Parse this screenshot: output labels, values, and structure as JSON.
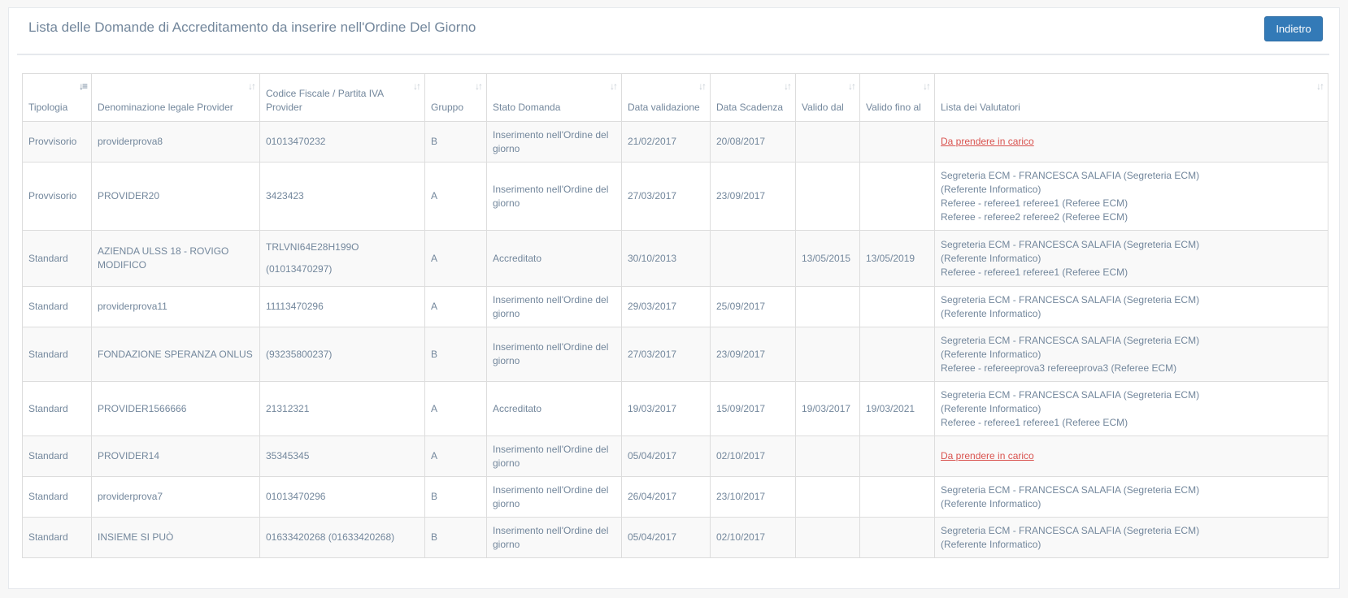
{
  "page": {
    "title": "Lista delle Domande di Accreditamento da inserire nell'Ordine Del Giorno",
    "back_label": "Indietro"
  },
  "table": {
    "headers": [
      "Tipologia",
      "Denominazione legale Provider",
      "Codice Fiscale / Partita IVA Provider",
      "Gruppo",
      "Stato Domanda",
      "Data validazione",
      "Data Scadenza",
      "Valido dal",
      "Valido fino al",
      "Lista dei Valutatori"
    ],
    "rows": [
      {
        "tipologia": "Provvisorio",
        "denominazione": "providerprova8",
        "codice": "01013470232",
        "gruppo": "B",
        "stato": "Inserimento nell'Ordine del giorno",
        "data_validazione": "21/02/2017",
        "data_scadenza": "20/08/2017",
        "valido_dal": "",
        "valido_fino": "",
        "valutatori_link": "Da prendere in carico",
        "valutatori": []
      },
      {
        "tipologia": "Provvisorio",
        "denominazione": "PROVIDER20",
        "codice": "3423423",
        "gruppo": "A",
        "stato": "Inserimento nell'Ordine del giorno",
        "data_validazione": "27/03/2017",
        "data_scadenza": "23/09/2017",
        "valido_dal": "",
        "valido_fino": "",
        "valutatori_link": "",
        "valutatori": [
          "Segreteria ECM - FRANCESCA SALAFIA (Segreteria ECM)",
          "(Referente Informatico)",
          "Referee - referee1 referee1 (Referee ECM)",
          "Referee - referee2 referee2 (Referee ECM)"
        ]
      },
      {
        "tipologia": "Standard",
        "denominazione": "AZIENDA ULSS 18 - ROVIGO MODIFICO",
        "codice": "TRLVNI64E28H199O",
        "codice_sub": "(01013470297)",
        "gruppo": "A",
        "stato": "Accreditato",
        "data_validazione": "30/10/2013",
        "data_scadenza": "",
        "valido_dal": "13/05/2015",
        "valido_fino": "13/05/2019",
        "valutatori_link": "",
        "valutatori": [
          "Segreteria ECM - FRANCESCA SALAFIA (Segreteria ECM)",
          "(Referente Informatico)",
          "Referee - referee1 referee1 (Referee ECM)"
        ]
      },
      {
        "tipologia": "Standard",
        "denominazione": "providerprova11",
        "codice": "11113470296",
        "gruppo": "A",
        "stato": "Inserimento nell'Ordine del giorno",
        "data_validazione": "29/03/2017",
        "data_scadenza": "25/09/2017",
        "valido_dal": "",
        "valido_fino": "",
        "valutatori_link": "",
        "valutatori": [
          "Segreteria ECM - FRANCESCA SALAFIA (Segreteria ECM)",
          "(Referente Informatico)"
        ]
      },
      {
        "tipologia": "Standard",
        "denominazione": "FONDAZIONE SPERANZA ONLUS",
        "codice": "(93235800237)",
        "gruppo": "B",
        "stato": "Inserimento nell'Ordine del giorno",
        "data_validazione": "27/03/2017",
        "data_scadenza": "23/09/2017",
        "valido_dal": "",
        "valido_fino": "",
        "valutatori_link": "",
        "valutatori": [
          "Segreteria ECM - FRANCESCA SALAFIA (Segreteria ECM)",
          "(Referente Informatico)",
          "Referee - refereeprova3 refereeprova3 (Referee ECM)"
        ]
      },
      {
        "tipologia": "Standard",
        "denominazione": "PROVIDER1566666",
        "codice": "21312321",
        "gruppo": "A",
        "stato": "Accreditato",
        "data_validazione": "19/03/2017",
        "data_scadenza": "15/09/2017",
        "valido_dal": "19/03/2017",
        "valido_fino": "19/03/2021",
        "valutatori_link": "",
        "valutatori": [
          "Segreteria ECM - FRANCESCA SALAFIA (Segreteria ECM)",
          "(Referente Informatico)",
          "Referee - referee1 referee1 (Referee ECM)"
        ]
      },
      {
        "tipologia": "Standard",
        "denominazione": "PROVIDER14",
        "codice": "35345345",
        "gruppo": "A",
        "stato": "Inserimento nell'Ordine del giorno",
        "data_validazione": "05/04/2017",
        "data_scadenza": "02/10/2017",
        "valido_dal": "",
        "valido_fino": "",
        "valutatori_link": "Da prendere in carico",
        "valutatori": []
      },
      {
        "tipologia": "Standard",
        "denominazione": "providerprova7",
        "codice": "01013470296",
        "gruppo": "B",
        "stato": "Inserimento nell'Ordine del giorno",
        "data_validazione": "26/04/2017",
        "data_scadenza": "23/10/2017",
        "valido_dal": "",
        "valido_fino": "",
        "valutatori_link": "",
        "valutatori": [
          "Segreteria ECM - FRANCESCA SALAFIA (Segreteria ECM)",
          "(Referente Informatico)"
        ]
      },
      {
        "tipologia": "Standard",
        "denominazione": "INSIEME SI PUÒ",
        "codice": "01633420268 (01633420268)",
        "gruppo": "B",
        "stato": "Inserimento nell'Ordine del giorno",
        "data_validazione": "05/04/2017",
        "data_scadenza": "02/10/2017",
        "valido_dal": "",
        "valido_fino": "",
        "valutatori_link": "",
        "valutatori": [
          "Segreteria ECM - FRANCESCA SALAFIA (Segreteria ECM)",
          "(Referente Informatico)"
        ]
      }
    ]
  },
  "icons": {
    "sort": "sort-icon",
    "sort_active": "sort-amount-asc-icon"
  },
  "colors": {
    "primary_button": "#337ab7",
    "link_danger": "#d9534f",
    "text": "#73879c"
  }
}
